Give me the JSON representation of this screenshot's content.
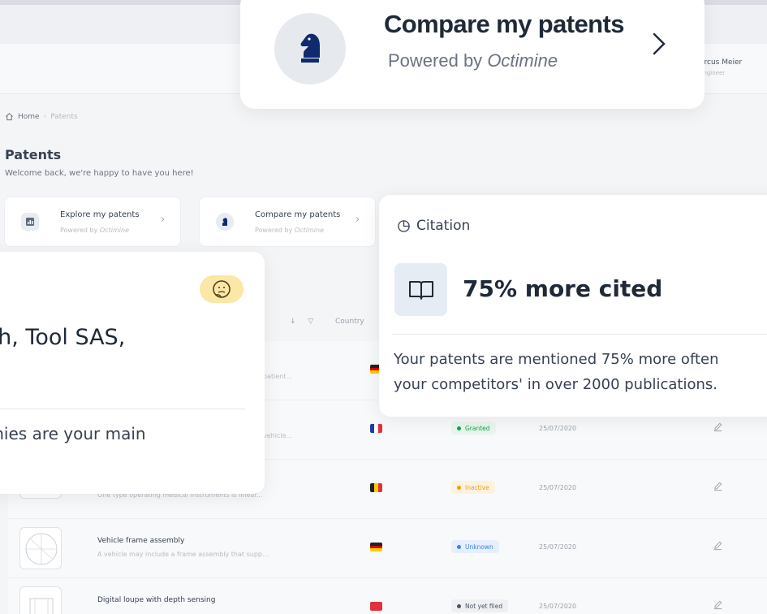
{
  "user": {
    "name": "arcus Meier",
    "role": "Engineer"
  },
  "breadcrumb": {
    "home": "Home",
    "current": "Patents"
  },
  "page": {
    "title": "Patents",
    "welcome": "Welcome back, we're happy to have you here!"
  },
  "mini_cards": [
    {
      "title": "Explore my patents",
      "subtitle_prefix": "Powered by",
      "subtitle_brand": "Octimine"
    },
    {
      "title": "Compare my patents",
      "subtitle_prefix": "Powered by",
      "subtitle_brand": "Octimine"
    }
  ],
  "table": {
    "country_header": "Country",
    "rows": [
      {
        "title": "",
        "description": "",
        "description_tail": "patient...",
        "flag": "de",
        "status": "",
        "date": ""
      },
      {
        "title": "",
        "description": "",
        "description_tail": "vehicle...",
        "flag": "fr",
        "status": "Granted",
        "status_color": "#16a34a",
        "status_bg": "#e8f6ee",
        "date": "25/07/2020"
      },
      {
        "title": "",
        "description": "One type operating medical instruments is linear...",
        "description_tail": "",
        "flag": "be",
        "status": "Inactive",
        "status_color": "#f59e0b",
        "status_bg": "#fdf1e0",
        "date": "25/07/2020"
      },
      {
        "title": "Vehicle frame assembly",
        "description": "A vehicle may include a frame assembly that supp...",
        "description_tail": "",
        "flag": "de",
        "status": "Unknown",
        "status_color": "#3b82f6",
        "status_bg": "#e6effb",
        "date": "25/07/2020"
      },
      {
        "title": "Digital loupe with depth sensing",
        "description": "",
        "description_tail": "",
        "flag": "cn",
        "status": "Not yet filed",
        "status_color": "#4b5563",
        "status_bg": "#eef0f3",
        "date": "25/07/2020"
      }
    ]
  },
  "compare_card": {
    "title": "Compare my patents",
    "subtitle_prefix": "Powered by",
    "subtitle_brand": "Octimine",
    "icon": "chess-knight-icon"
  },
  "competitor_card": {
    "headline": "ph, Tool SAS,",
    "subtext": "anies are your main",
    "icon": "thinking-emoji-icon"
  },
  "citation_card": {
    "header": "Citation",
    "headline": "75% more cited",
    "text_line1": "Your patents are mentioned 75% more often",
    "text_line2": "your competitors' in over 2000 publications.",
    "icon": "open-book-icon"
  },
  "colors": {
    "accent": "#0f2a6e",
    "emoji_bg": "#fbe7a6"
  }
}
